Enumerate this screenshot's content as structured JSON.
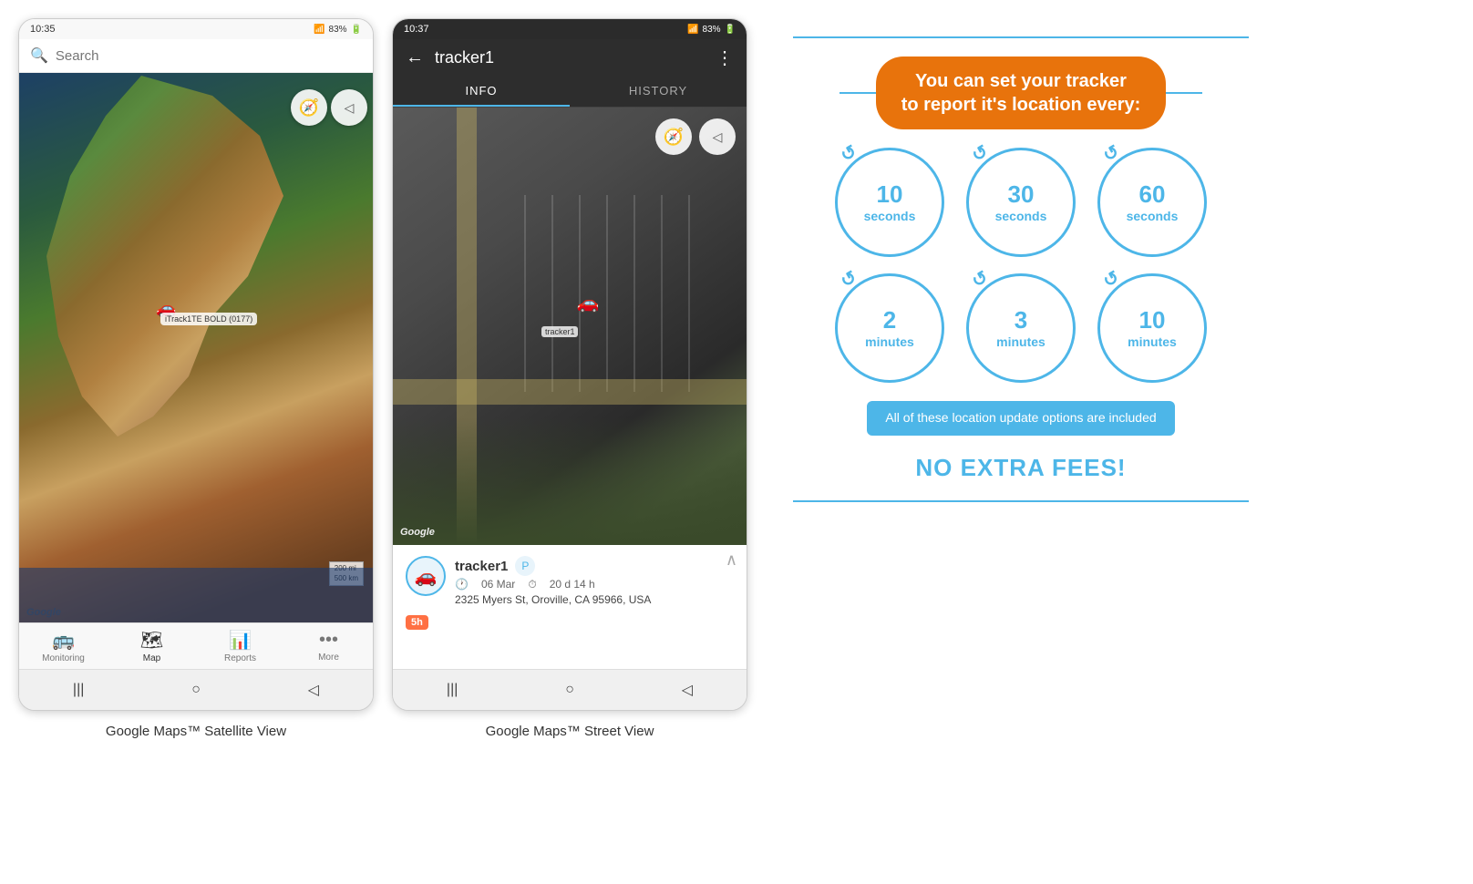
{
  "screen1": {
    "status_time": "10:35",
    "status_signal": "📶",
    "status_battery": "83%",
    "search_placeholder": "Search",
    "compass_icon": "⊕",
    "navigate_icon": "◁",
    "tracker_label": "iTrack1TE BOLD (0177)",
    "scale_text": "200 mi\n500 km",
    "google_logo": "Google",
    "nav_items": [
      {
        "icon": "🚌",
        "label": "Monitoring",
        "active": false
      },
      {
        "icon": "🗺",
        "label": "Map",
        "active": true
      },
      {
        "icon": "📊",
        "label": "Reports",
        "active": false
      },
      {
        "icon": "•••",
        "label": "More",
        "active": false
      }
    ],
    "caption": "Google Maps™ Satellite View"
  },
  "screen2": {
    "status_time": "10:37",
    "status_battery": "83%",
    "back_icon": "←",
    "title": "tracker1",
    "more_icon": "⋮",
    "tab_info": "INFO",
    "tab_history": "HISTORY",
    "compass_icon": "⊕",
    "navigate_icon": "◁",
    "google_logo": "Google",
    "tracker_name": "tracker1",
    "tracker_date": "06 Mar",
    "tracker_duration": "20 d 14 h",
    "tracker_address": "2325 Myers St, Oroville, CA 95966, USA",
    "badge_5h": "5h",
    "car_label": "tracker1",
    "caption": "Google Maps™ Street View"
  },
  "info_panel": {
    "headline_line1": "You can set your tracker",
    "headline_line2": "to report it's location every:",
    "circles": [
      {
        "value": "10",
        "unit": "seconds"
      },
      {
        "value": "30",
        "unit": "seconds"
      },
      {
        "value": "60",
        "unit": "seconds"
      },
      {
        "value": "2",
        "unit": "minutes"
      },
      {
        "value": "3",
        "unit": "minutes"
      },
      {
        "value": "10",
        "unit": "minutes"
      }
    ],
    "no_fee_text": "All of these location update options are included",
    "no_extra_fees": "NO EXTRA FEES!"
  }
}
